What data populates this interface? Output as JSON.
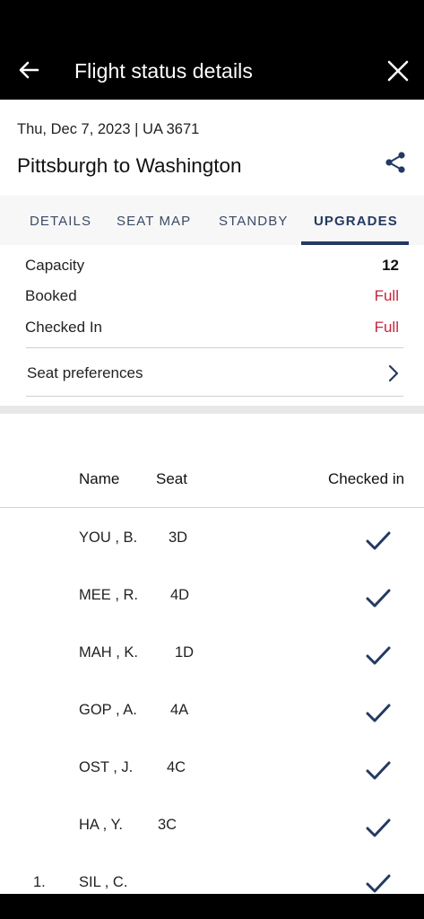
{
  "header": {
    "title": "Flight status details",
    "back_icon": "arrow-left-icon",
    "close_icon": "close-icon"
  },
  "flight": {
    "date_flight": "Thu, Dec 7, 2023 | UA 3671",
    "route": "Pittsburgh to Washington",
    "share_icon": "share-icon"
  },
  "tabs": [
    {
      "label": "DETAILS",
      "active": false
    },
    {
      "label": "SEAT MAP",
      "active": false
    },
    {
      "label": "STANDBY",
      "active": false
    },
    {
      "label": "UPGRADES",
      "active": true
    }
  ],
  "stats": {
    "capacity_label": "Capacity",
    "capacity_value": "12",
    "booked_label": "Booked",
    "booked_value": "Full",
    "checked_in_label": "Checked In",
    "checked_in_value": "Full"
  },
  "preferences": {
    "label": "Seat preferences"
  },
  "table": {
    "headers": {
      "name": "Name",
      "seat": "Seat",
      "checked_in": "Checked in"
    },
    "rows": [
      {
        "num": "",
        "name": "YOU , B.",
        "seat": "3D",
        "checked_in": true
      },
      {
        "num": "",
        "name": "MEE , R.",
        "seat": "4D",
        "checked_in": true
      },
      {
        "num": "",
        "name": "MAH , K.",
        "seat": "1D",
        "checked_in": true
      },
      {
        "num": "",
        "name": "GOP , A.",
        "seat": "4A",
        "checked_in": true
      },
      {
        "num": "",
        "name": "OST , J.",
        "seat": "4C",
        "checked_in": true
      },
      {
        "num": "",
        "name": "HA , Y.",
        "seat": "3C",
        "checked_in": true
      },
      {
        "num": "1.",
        "name": "SIL , C.",
        "seat": "",
        "checked_in": true
      }
    ]
  },
  "colors": {
    "accent": "#233a62",
    "alert": "#c5283d",
    "appbar": "#000000"
  }
}
